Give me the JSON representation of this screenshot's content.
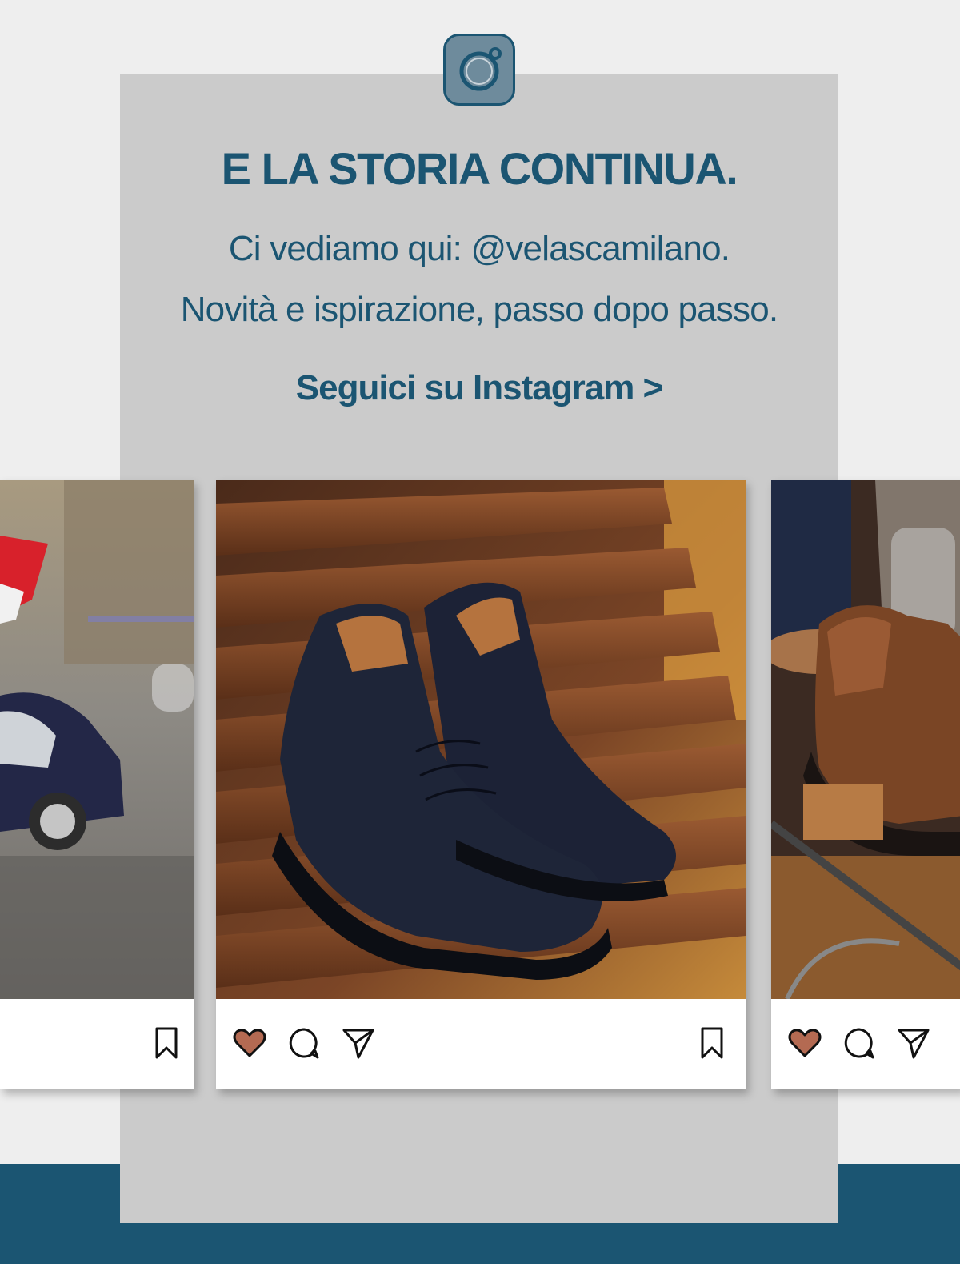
{
  "header": {
    "icon": "instagram-icon",
    "title": "E LA STORIA CONTINUA.",
    "line1": "Ci vediamo qui: @velascamilano.",
    "line2": "Novità e ispirazione, passo dopo passo.",
    "cta_label": "Seguici su Instagram >"
  },
  "colors": {
    "brand_blue": "#1b5572",
    "card_gray": "#cbcbcb",
    "page_bg": "#eeeeee",
    "heart": "#b46a52"
  },
  "posts": [
    {
      "image": "fiat-500-with-italian-flag",
      "icons": [
        "bookmark-icon"
      ]
    },
    {
      "image": "navy-suede-chukka-boots-on-bench",
      "icons": [
        "heart-icon",
        "comment-icon",
        "share-icon",
        "bookmark-icon"
      ]
    },
    {
      "image": "brown-leather-hiking-boot",
      "icons": [
        "heart-icon",
        "comment-icon",
        "share-icon"
      ]
    }
  ]
}
